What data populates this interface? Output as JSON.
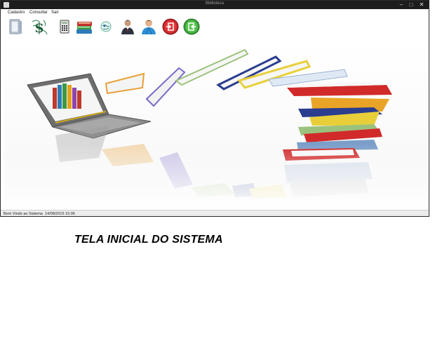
{
  "window": {
    "title": "Biblioteca"
  },
  "menu": {
    "items": [
      "Cadastro",
      "Consultar",
      "Sair"
    ]
  },
  "toolbar": {
    "buttons": [
      {
        "icon": "cabinet-icon"
      },
      {
        "icon": "dollar-scribble-icon"
      },
      {
        "icon": "calculator-icon"
      },
      {
        "icon": "books-stack-icon"
      },
      {
        "icon": "globe-icon"
      },
      {
        "icon": "businessman-icon"
      },
      {
        "icon": "user-icon"
      },
      {
        "icon": "logout-icon"
      },
      {
        "icon": "exit-icon"
      }
    ]
  },
  "status": {
    "welcome": "Bem Vindo ao Sistema",
    "datetime": "14/08/2015  15:06"
  },
  "caption": "TELA INICIAL DO SISTEMA"
}
